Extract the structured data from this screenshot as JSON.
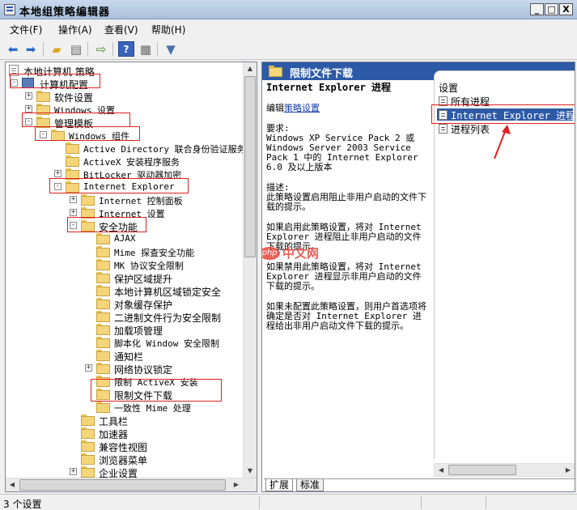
{
  "window": {
    "title": "本地组策略编辑器",
    "buttons": {
      "minimize": "_",
      "maximize": "□",
      "close": "X"
    }
  },
  "menu": [
    {
      "label": "文件(F)"
    },
    {
      "label": "操作(A)"
    },
    {
      "label": "查看(V)"
    },
    {
      "label": "帮助(H)"
    }
  ],
  "toolbar": {
    "icons": [
      "back-icon",
      "forward-icon",
      "up-folder-icon",
      "show-hide-tree-icon",
      "export-list-icon",
      "help-icon",
      "properties-icon",
      "filter-icon"
    ]
  },
  "tree": {
    "items": [
      {
        "label": "本地计算机 策略"
      },
      {
        "label": "计算机配置",
        "expander": "-"
      },
      {
        "label": "软件设置",
        "expander": "+"
      },
      {
        "label": "Windows 设置",
        "expander": "+"
      },
      {
        "label": "管理模板",
        "expander": "-"
      },
      {
        "label": "Windows 组件",
        "expander": "-"
      },
      {
        "label": "Active Directory 联合身份验证服务"
      },
      {
        "label": "ActiveX 安装程序服务"
      },
      {
        "label": "BitLocker 驱动器加密",
        "expander": "+"
      },
      {
        "label": "Internet Explorer",
        "expander": "-"
      },
      {
        "label": "Internet 控制面板",
        "expander": "+"
      },
      {
        "label": "Internet 设置",
        "expander": "+"
      },
      {
        "label": "安全功能",
        "expander": "-"
      },
      {
        "label": "AJAX"
      },
      {
        "label": "Mime 探查安全功能"
      },
      {
        "label": "MK 协议安全限制"
      },
      {
        "label": "保护区域提升"
      },
      {
        "label": "本地计算机区域锁定安全"
      },
      {
        "label": "对象缓存保护"
      },
      {
        "label": "二进制文件行为安全限制"
      },
      {
        "label": "加载项管理"
      },
      {
        "label": "脚本化 Window 安全限制"
      },
      {
        "label": "通知栏"
      },
      {
        "label": "网络协议锁定",
        "expander": "+"
      },
      {
        "label": "限制 ActiveX 安装"
      },
      {
        "label": "限制文件下载"
      },
      {
        "label": "一致性 Mime 处理"
      },
      {
        "label": "工具栏"
      },
      {
        "label": "加速器"
      },
      {
        "label": "兼容性视图"
      },
      {
        "label": "浏览器菜单"
      },
      {
        "label": "企业设置",
        "expander": "+"
      }
    ]
  },
  "detail": {
    "header": "限制文件下载",
    "policy_title": "Internet Explorer 进程",
    "edit_prefix": "编辑",
    "edit_link": "策略设置",
    "requirements_label": "要求:",
    "requirements_text": "Windows XP Service Pack 2 或 Windows Server 2003 Service Pack 1 中的 Internet Explorer 6.0 及以上版本",
    "description_label": "描述:",
    "description_text": "此策略设置启用阻止非用户启动的文件下载的提示。",
    "enabled_text": "如果启用此策略设置，将对 Internet Explorer 进程阻止非用户启动的文件下载的提示。",
    "disabled_text": "如果禁用此策略设置，将对 Internet Explorer 进程显示非用户启动的文件下载的提示。",
    "notconfigured_text": "如果未配置此策略设置，则用户首选项将确定是否对 Internet Explorer 进程给出非用户启动文件下载的提示。"
  },
  "settings": {
    "header": "设置",
    "items": [
      {
        "label": "所有进程",
        "selected": false
      },
      {
        "label": "Internet Explorer 进程",
        "selected": true
      },
      {
        "label": "进程列表",
        "selected": false
      }
    ]
  },
  "tabs": [
    {
      "label": "扩展"
    },
    {
      "label": "标准"
    }
  ],
  "watermark": {
    "logo": "php",
    "text": "中文网"
  },
  "status": {
    "text": "3 个设置"
  },
  "colors": {
    "highlight": "#2d5aa6",
    "annotation": "#e02020"
  }
}
